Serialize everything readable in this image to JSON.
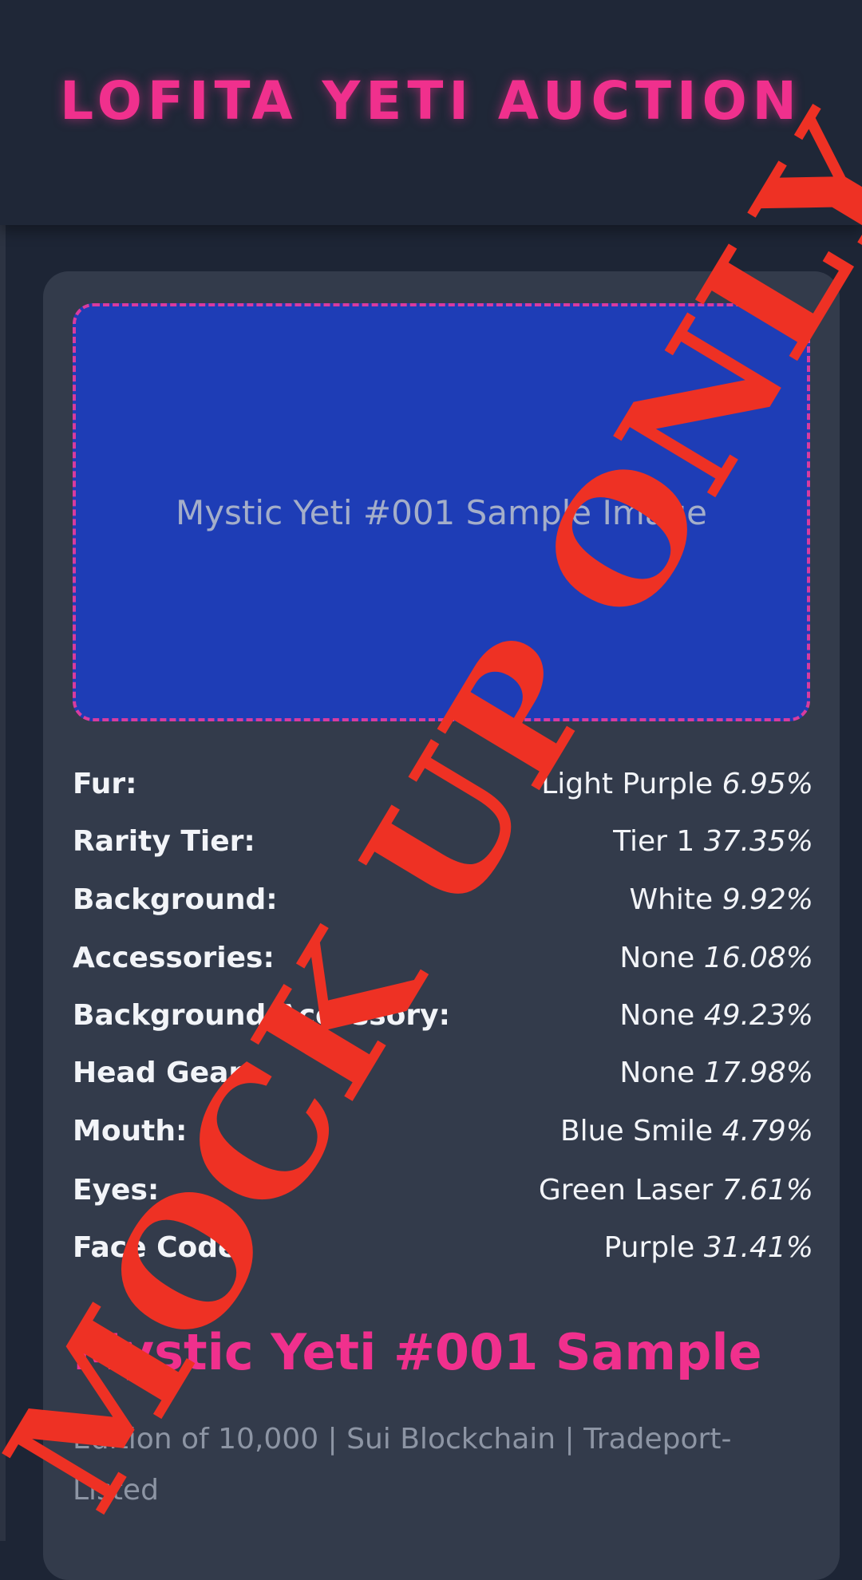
{
  "app_title": "LOFITA YETI AUCTION",
  "image_caption": "Mystic Yeti #001 Sample Image",
  "traits": [
    {
      "name": "Fur:",
      "value": "Light Purple",
      "percent": "6.95%"
    },
    {
      "name": "Rarity Tier:",
      "value": "Tier 1",
      "percent": "37.35%"
    },
    {
      "name": "Background:",
      "value": "White",
      "percent": "9.92%"
    },
    {
      "name": "Accessories:",
      "value": "None",
      "percent": "16.08%"
    },
    {
      "name": "Background Accessory:",
      "value": "None",
      "percent": "49.23%"
    },
    {
      "name": "Head Gear:",
      "value": "None",
      "percent": "17.98%"
    },
    {
      "name": "Mouth:",
      "value": "Blue Smile",
      "percent": "4.79%"
    },
    {
      "name": "Eyes:",
      "value": "Green Laser",
      "percent": "7.61%"
    },
    {
      "name": "Face Code:",
      "value": "Purple",
      "percent": "31.41%"
    }
  ],
  "nft_name": "Mystic Yeti #001 Sample",
  "nft_meta": "Edition of 10,000 | Sui Blockchain | Tradeport-Listed",
  "watermark_text": "MOCK UP ONLY",
  "colors": {
    "accent_pink": "#f0308d",
    "placeholder_blue": "#1e3db6",
    "watermark_red": "#ee3124"
  }
}
